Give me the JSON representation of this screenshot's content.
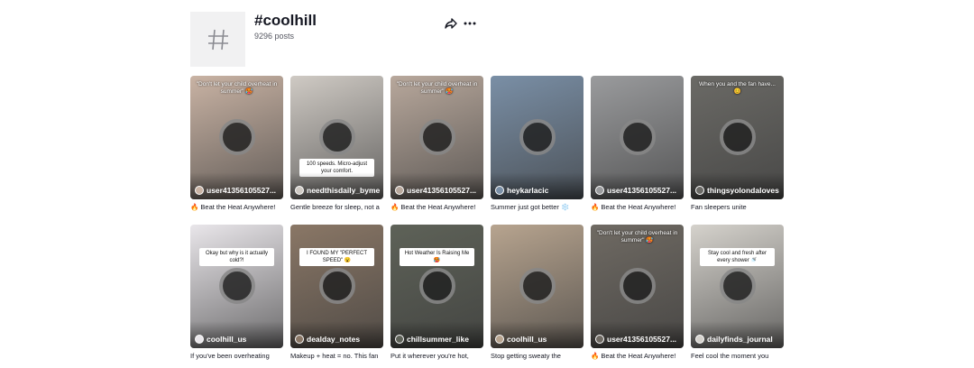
{
  "header": {
    "title": "#coolhill",
    "posts": "9296 posts",
    "tag_icon": "hashtag-icon",
    "share_icon": "share-icon",
    "more_icon": "more-icon"
  },
  "videos": [
    {
      "username": "user41356105527...",
      "description": "🔥 Beat the Heat Anywhere!",
      "overlay": "\"Don't let your child overheat in summer\" 🥵",
      "theme": "#c9b3a4"
    },
    {
      "username": "needthisdaily_byme",
      "description": "Gentle breeze for sleep, not a",
      "overlay": "100 speeds. Micro-adjust your comfort.",
      "theme": "#cfcac4"
    },
    {
      "username": "user41356105527...",
      "description": "🔥 Beat the Heat Anywhere!",
      "overlay": "\"Don't let your child overheat in summer\" 🥵",
      "theme": "#b8a89c"
    },
    {
      "username": "heykarlacic",
      "description": "Summer just got better ❄️",
      "overlay": "",
      "theme": "#7a8fa6"
    },
    {
      "username": "user41356105527...",
      "description": "🔥 Beat the Heat Anywhere!",
      "overlay": "",
      "theme": "#9a9b9d"
    },
    {
      "username": "thingsyolondaloves",
      "description": "Fan sleepers unite",
      "overlay": "When you and the fan have... 😊",
      "theme": "#6b6a66"
    },
    {
      "username": "coolhill_us",
      "description": "If you've been overheating",
      "overlay": "Okay but why is it actually cold?!",
      "theme": "#e9e6ea"
    },
    {
      "username": "dealday_notes",
      "description": "Makeup + heat = no. This fan",
      "overlay": "I FOUND MY \"PERFECT SPEED\" 😮",
      "theme": "#8a7766"
    },
    {
      "username": "chillsummer_like",
      "description": "Put it wherever you're hot,",
      "overlay": "Hot Weather Is Raising Me 🥵",
      "theme": "#5e6258"
    },
    {
      "username": "coolhill_us",
      "description": "Stop getting sweaty the",
      "overlay": "",
      "theme": "#b7a48f"
    },
    {
      "username": "user41356105527...",
      "description": "🔥 Beat the Heat Anywhere!",
      "overlay": "\"Don't let your child overheat in summer\" 🥵",
      "theme": "#6f6a63"
    },
    {
      "username": "dailyfinds_journal",
      "description": "Feel cool the moment you",
      "overlay": "Stay cool and fresh after every shower 🚿",
      "theme": "#d5d2cc"
    }
  ]
}
